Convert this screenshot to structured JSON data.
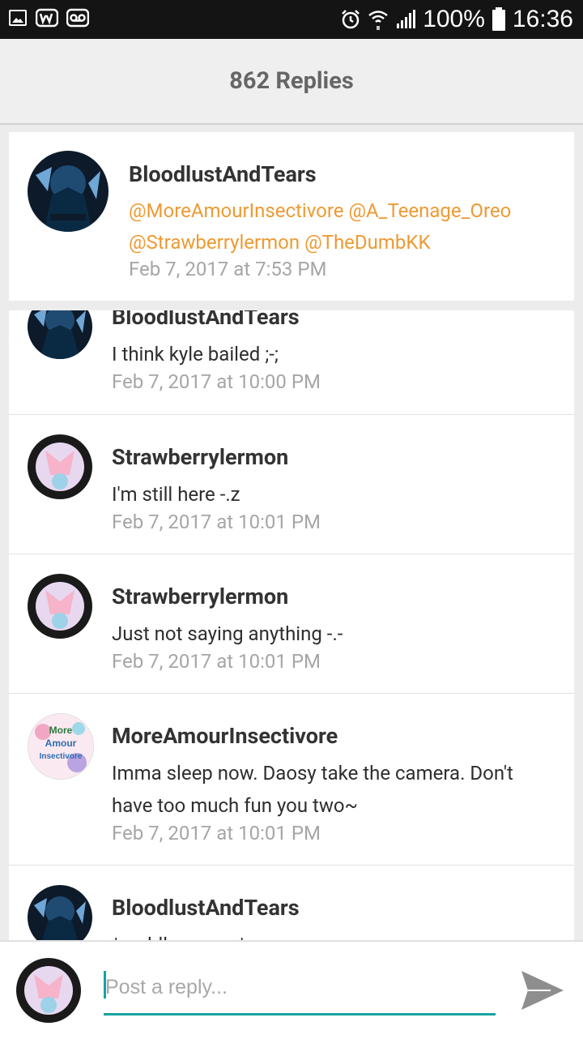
{
  "status_bar": {
    "battery": "100%",
    "time": "16:36"
  },
  "header": {
    "title": "862 Replies"
  },
  "op": {
    "author": "BloodlustAndTears",
    "mentions_line1": "@MoreAmourInsectivore @A_Teenage_Oreo",
    "mentions_line2": "@Strawberrylermon @TheDumbKK",
    "timestamp": "Feb 7, 2017 at 7:53 PM"
  },
  "replies": [
    {
      "author": "BloodlustAndTears",
      "text": "I think kyle bailed ;-;",
      "timestamp": "Feb 7, 2017 at 10:00 PM",
      "avatar": "dark-avatar"
    },
    {
      "author": "Strawberrylermon",
      "text": "I'm still here -.z",
      "timestamp": "Feb 7, 2017 at 10:01 PM",
      "avatar": "pink-avatar"
    },
    {
      "author": "Strawberrylermon",
      "text": "Just not saying anything -.-",
      "timestamp": "Feb 7, 2017 at 10:01 PM",
      "avatar": "pink-avatar"
    },
    {
      "author": "MoreAmourInsectivore",
      "text_line1": "Imma sleep now. Daosy take the camera. Don't",
      "text_line2": "have too much fun you two~",
      "timestamp": "Feb 7, 2017 at 10:01 PM",
      "avatar": "more-amour-avatar"
    },
    {
      "author": "BloodlustAndTears",
      "text": "*cuddles more*",
      "avatar": "dark-avatar"
    }
  ],
  "composer": {
    "placeholder": "Post a reply..."
  },
  "colors": {
    "mention": "#ee9a33",
    "accent": "#17a1a0",
    "status_bar": "#141414"
  }
}
